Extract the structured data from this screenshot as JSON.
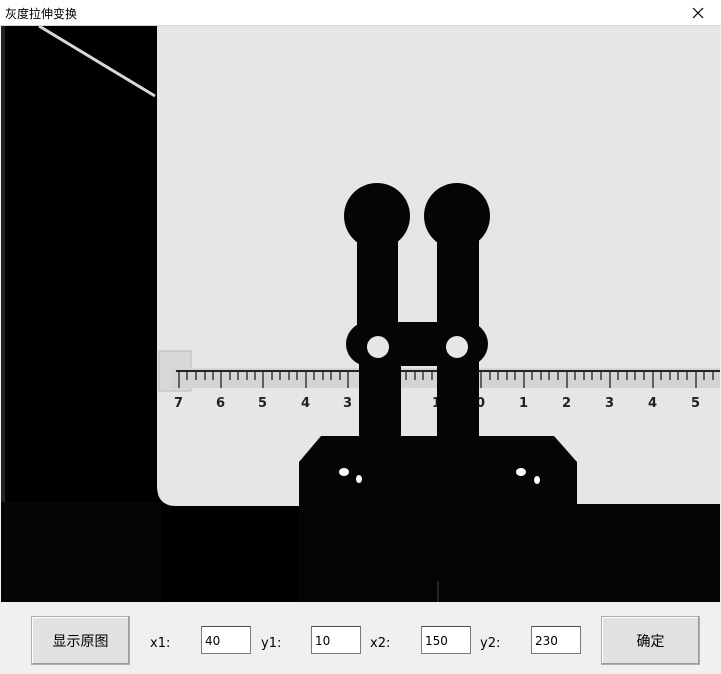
{
  "window": {
    "title": "灰度拉伸变换",
    "close_icon": "close-icon"
  },
  "image": {
    "description_icon": "grayscale-image"
  },
  "controls": {
    "show_original_label": "显示原图",
    "x1_label": "x1:",
    "y1_label": "y1:",
    "x2_label": "x2:",
    "y2_label": "y2:",
    "x1_value": "40",
    "y1_value": "10",
    "x2_value": "150",
    "y2_value": "230",
    "confirm_label": "确定"
  },
  "ruler": {
    "numbers": [
      "7",
      "6",
      "5",
      "4",
      "3",
      "1",
      "0",
      "1",
      "2",
      "3",
      "4",
      "5"
    ]
  }
}
